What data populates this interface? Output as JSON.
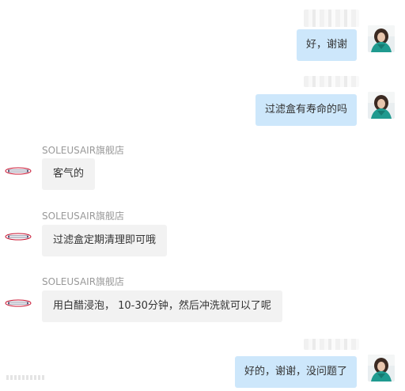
{
  "conversation": {
    "messages": [
      {
        "direction": "outgoing",
        "text": "好，谢谢"
      },
      {
        "direction": "outgoing",
        "text": "过滤盒有寿命的吗"
      },
      {
        "direction": "incoming",
        "sender": "SOLEUSAIR旗舰店",
        "text": "客气的"
      },
      {
        "direction": "incoming",
        "sender": "SOLEUSAIR旗舰店",
        "text": "过滤盒定期清理即可哦"
      },
      {
        "direction": "incoming",
        "sender": "SOLEUSAIR旗舰店",
        "text": "用白醋浸泡， 10-30分钟，然后冲洗就可以了呢"
      },
      {
        "direction": "outgoing",
        "text": "好的，谢谢，没问题了"
      }
    ]
  },
  "colors": {
    "outgoing_bubble": "#cde7fb",
    "incoming_bubble": "#f2f2f2",
    "sender_name": "#999999",
    "logo_red": "#c8102e"
  },
  "icons": {
    "user_avatar": "user-avatar-photo",
    "shop_avatar": "soleusair-logo"
  }
}
